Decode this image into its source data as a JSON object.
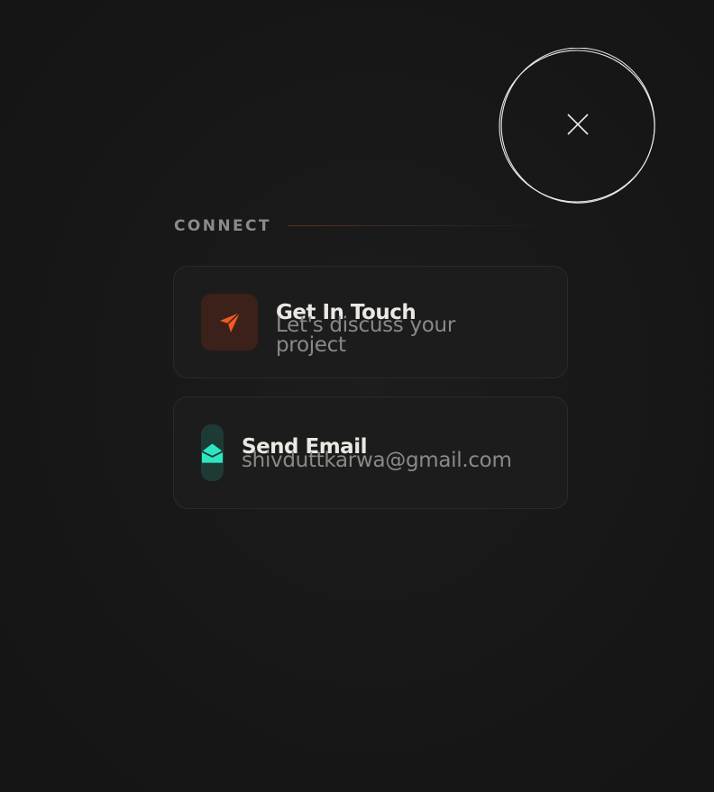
{
  "close_button": {
    "icon": "close-icon"
  },
  "section": {
    "title": "CONNECT"
  },
  "cards": [
    {
      "title": "Get In Touch",
      "subtitle": "Let's discuss your project",
      "icon": "paper-plane-icon",
      "accent": "#f25a24",
      "icon_bg": "#3b2119"
    },
    {
      "title": "Send Email",
      "subtitle": "shivduttkarwa@gmail.com",
      "icon": "envelope-open-icon",
      "accent": "#2ee6c0",
      "icon_bg": "#1e3a35"
    }
  ]
}
